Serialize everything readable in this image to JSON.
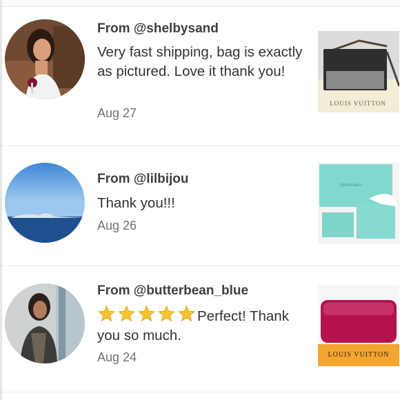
{
  "reviews": [
    {
      "author": "From @shelbysand",
      "comment": "Very fast shipping, bag is exactly as pictured. Love it thank you!",
      "date": "Aug 27",
      "product_brand": "LOUIS VUITTON"
    },
    {
      "author": "From @lilbijou",
      "comment": "Thank you!!!",
      "date": "Aug 26",
      "product_brand": "TIFFANY&CO."
    },
    {
      "author": "From @butterbean_blue",
      "star_count": 5,
      "comment": "Perfect! Thank you so much.",
      "date": "Aug 24",
      "product_brand": "LOUIS VUITTON"
    }
  ],
  "colors": {
    "tiffany_blue": "#81d8d0",
    "lv_fuchsia": "#b3124f",
    "star_gold": "#f7c531"
  }
}
